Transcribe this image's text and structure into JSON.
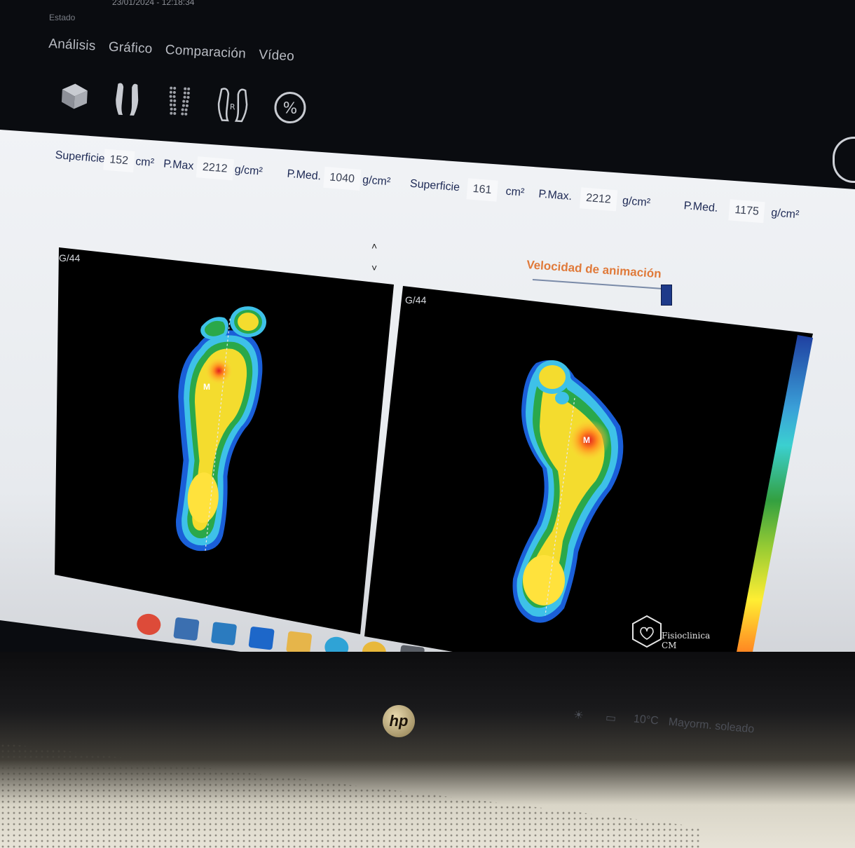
{
  "header": {
    "title_text": "23/01/2024 - 12:18:34",
    "file_label": "Estado"
  },
  "menu": {
    "items": [
      {
        "label": "Análisis"
      },
      {
        "label": "Gráfico"
      },
      {
        "label": "Comparación"
      },
      {
        "label": "Vídeo"
      }
    ]
  },
  "toolbar": {
    "buttons": [
      {
        "icon": "cube-3d-icon"
      },
      {
        "icon": "feet-silhouette-icon"
      },
      {
        "icon": "feet-dotted-icon"
      },
      {
        "icon": "feet-outline-icon"
      },
      {
        "icon": "percent-icon",
        "label": "%"
      }
    ]
  },
  "left_foot": {
    "surface_label": "Superficie",
    "surface_value": "152",
    "surface_unit": "cm²",
    "pmax_label": "P.Max",
    "pmax_value": "2212",
    "pmax_unit": "g/cm²",
    "pmed_label": "P.Med.",
    "pmed_value": "1040",
    "pmed_unit": "g/cm²",
    "size_tag": "G/44"
  },
  "right_foot": {
    "surface_label": "Superficie",
    "surface_value": "161",
    "surface_unit": "cm²",
    "pmax_label": "P.Max.",
    "pmax_value": "2212",
    "pmax_unit": "g/cm²",
    "pmed_label": "P.Med.",
    "pmed_value": "1175",
    "pmed_unit": "g/cm²",
    "size_tag": "G/44"
  },
  "animation": {
    "speed_label": "Velocidad de animación",
    "speed_level": 1.0
  },
  "pressure_marker": "M",
  "watermark": {
    "text": "Fisioclinica CM"
  },
  "taskbar": {
    "icons": [
      "chrome-icon",
      "file-explorer-icon",
      "store-icon",
      "dropbox-icon",
      "folder-icon",
      "edge-icon",
      "norton-icon",
      "app-feet-icon"
    ]
  },
  "status_bar": {
    "temperature": "10°C",
    "weather": "Mayorm. soleado"
  },
  "laptop": {
    "brand": "hp"
  }
}
